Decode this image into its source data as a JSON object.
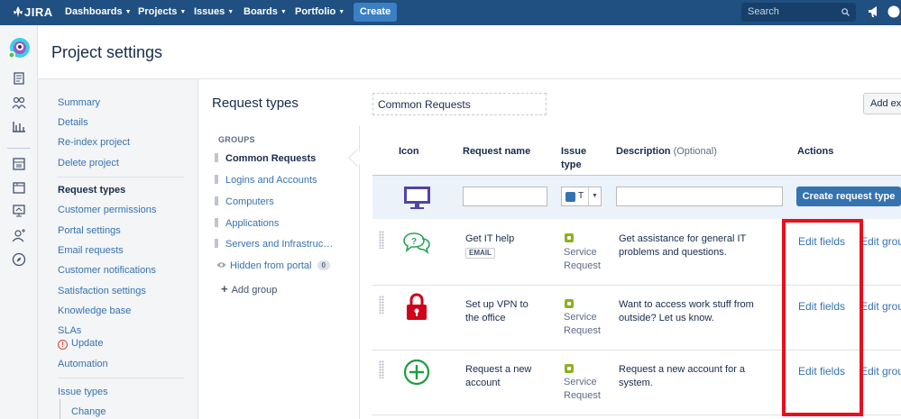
{
  "topbar": {
    "logo": "JIRA",
    "nav": [
      "Dashboards",
      "Projects",
      "Issues",
      "Boards",
      "Portfolio"
    ],
    "create": "Create",
    "search_placeholder": "Search"
  },
  "page": {
    "title": "Project settings"
  },
  "left_nav": {
    "items": [
      "Summary",
      "Details",
      "Re-index project",
      "Delete project"
    ],
    "items2": [
      "Request types",
      "Customer permissions",
      "Portal settings",
      "Email requests",
      "Customer notifications",
      "Satisfaction settings",
      "Knowledge base"
    ],
    "slas": "SLAs",
    "slas_update": "Update",
    "automation": "Automation",
    "issue_types": "Issue types",
    "change": "Change"
  },
  "request_types": {
    "title": "Request types",
    "groups_label": "GROUPS",
    "groups": [
      "Common Requests",
      "Logins and Accounts",
      "Computers",
      "Applications",
      "Servers and Infrastruct…"
    ],
    "hidden": "Hidden from portal",
    "hidden_count": "0",
    "add_group": "Add group"
  },
  "main": {
    "group_name": "Common Requests",
    "add_existing": "Add exi",
    "headers": {
      "icon": "Icon",
      "name": "Request name",
      "type": "Issue type",
      "description": "Description",
      "optional": "(Optional)",
      "actions": "Actions"
    },
    "create_row": {
      "issue_type_short": "T",
      "button": "Create request type"
    },
    "rows": [
      {
        "name": "Get IT help",
        "badge": "EMAIL",
        "type": "Service Request",
        "description": "Get assistance for general IT problems and questions.",
        "edit_fields": "Edit fields",
        "edit_groups": "Edit grou"
      },
      {
        "name": "Set up VPN to the office",
        "type": "Service Request",
        "description": "Want to access work stuff from outside? Let us know.",
        "edit_fields": "Edit fields",
        "edit_groups": "Edit grou"
      },
      {
        "name": "Request a new account",
        "type": "Service Request",
        "description": "Request a new account for a system.",
        "edit_fields": "Edit fields",
        "edit_groups": "Edit grou"
      }
    ]
  },
  "colors": {
    "topbar": "#205081",
    "link": "#3572b0",
    "highlight": "#e8101c",
    "service_request": "#8eb021"
  }
}
